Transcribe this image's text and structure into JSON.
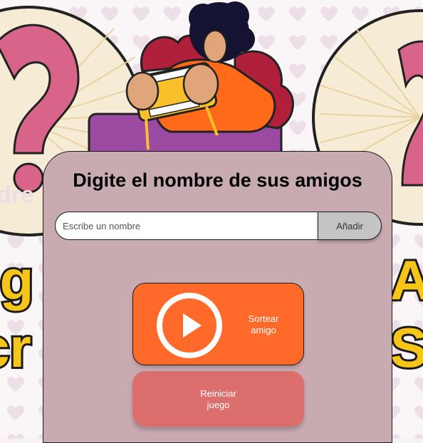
{
  "card": {
    "title": "Digite el nombre de sus amigos",
    "input_placeholder": "Escribe un nombre",
    "add_label": "Añadir",
    "draw_label_line1": "Sortear",
    "draw_label_line2": "amigo",
    "reset_label_line1": "Reiniciar",
    "reset_label_line2": "juego"
  },
  "banner": {
    "left_letters": "Ami\ngre",
    "right_letters": "Am\nSe"
  },
  "icons": {
    "play": "play-icon",
    "question_marks": "question-mark-icon"
  },
  "colors": {
    "card_bg": "#c8abb1",
    "draw_button": "#ff6a2a",
    "reset_button": "#dc6e6e",
    "add_button": "#c4c4c4",
    "accent_yellow": "#f5c518",
    "pink": "#d8648a"
  }
}
